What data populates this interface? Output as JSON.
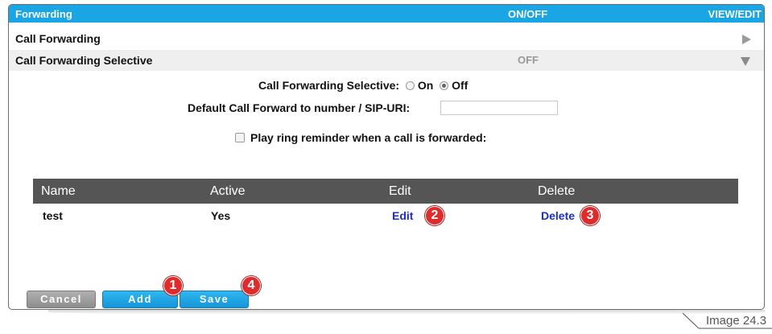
{
  "header": {
    "title": "Forwarding",
    "col_on_off": "ON/OFF",
    "col_view_edit": "VIEW/EDIT",
    "bg_color": "#1aa6e4"
  },
  "sections": {
    "call_forwarding": {
      "label": "Call Forwarding"
    },
    "call_forwarding_selective": {
      "label": "Call Forwarding Selective",
      "status": "OFF"
    }
  },
  "form": {
    "selective_label": "Call Forwarding Selective:",
    "on_label": "On",
    "off_label": "Off",
    "selected": "Off",
    "default_forward_label": "Default Call Forward to number / SIP-URI:",
    "default_forward_value": "",
    "ring_reminder_label": "Play ring reminder when a call is forwarded:",
    "ring_reminder_checked": false
  },
  "table": {
    "headers": {
      "name": "Name",
      "active": "Active",
      "edit": "Edit",
      "delete": "Delete"
    },
    "rows": [
      {
        "name": "test",
        "active": "Yes",
        "edit": "Edit",
        "delete": "Delete"
      }
    ]
  },
  "buttons": {
    "cancel": "Cancel",
    "add": "Add",
    "save": "Save"
  },
  "badges": {
    "add": "1",
    "edit": "2",
    "delete": "3",
    "save": "4"
  },
  "caption": "Image 24.3"
}
